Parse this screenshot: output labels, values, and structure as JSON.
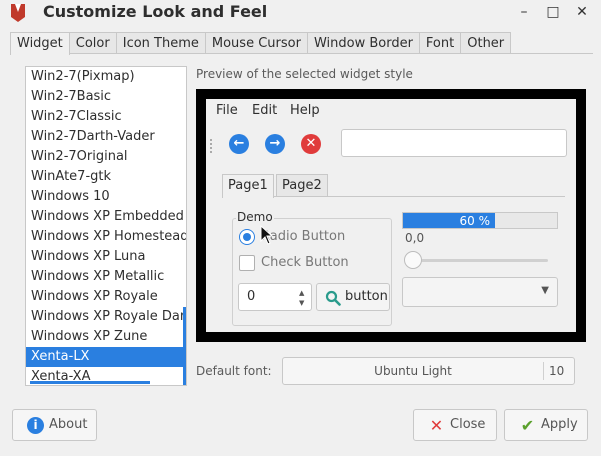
{
  "window": {
    "title": "Customize Look and Feel",
    "controls": {
      "minimize": "–",
      "maximize": "□",
      "close": "✕"
    }
  },
  "tabs": [
    "Widget",
    "Color",
    "Icon Theme",
    "Mouse Cursor",
    "Window Border",
    "Font",
    "Other"
  ],
  "active_tab": "Widget",
  "theme_list": {
    "items": [
      "Win2-7(Pixmap)",
      "Win2-7Basic",
      "Win2-7Classic",
      "Win2-7Darth-Vader",
      "Win2-7Original",
      "WinAte7-gtk",
      "Windows 10",
      "Windows XP Embedded",
      "Windows XP Homestead",
      "Windows XP Luna",
      "Windows XP Metallic",
      "Windows XP Royale",
      "Windows XP Royale Dark",
      "Windows XP Zune",
      "Xenta-LX",
      "Xenta-XA"
    ],
    "selected": "Xenta-LX"
  },
  "preview": {
    "label": "Preview of the selected widget style",
    "menus": [
      "File",
      "Edit",
      "Help"
    ],
    "toolbar_icons": [
      "back-icon",
      "forward-icon",
      "stop-icon"
    ],
    "notebook_tabs": [
      "Page1",
      "Page2"
    ],
    "frame_label": "Demo",
    "radio_label": "Radio Button",
    "check_label": "Check Button",
    "spin_value": "0",
    "button_label": "button",
    "progress_text": "60 %",
    "progress_fraction": 0.6,
    "scale_value": "0,0",
    "accent": "#2a7fe0"
  },
  "default_font": {
    "label": "Default font:",
    "name": "Ubuntu Light",
    "size": "10"
  },
  "buttons": {
    "about": "About",
    "close": "Close",
    "apply": "Apply"
  }
}
